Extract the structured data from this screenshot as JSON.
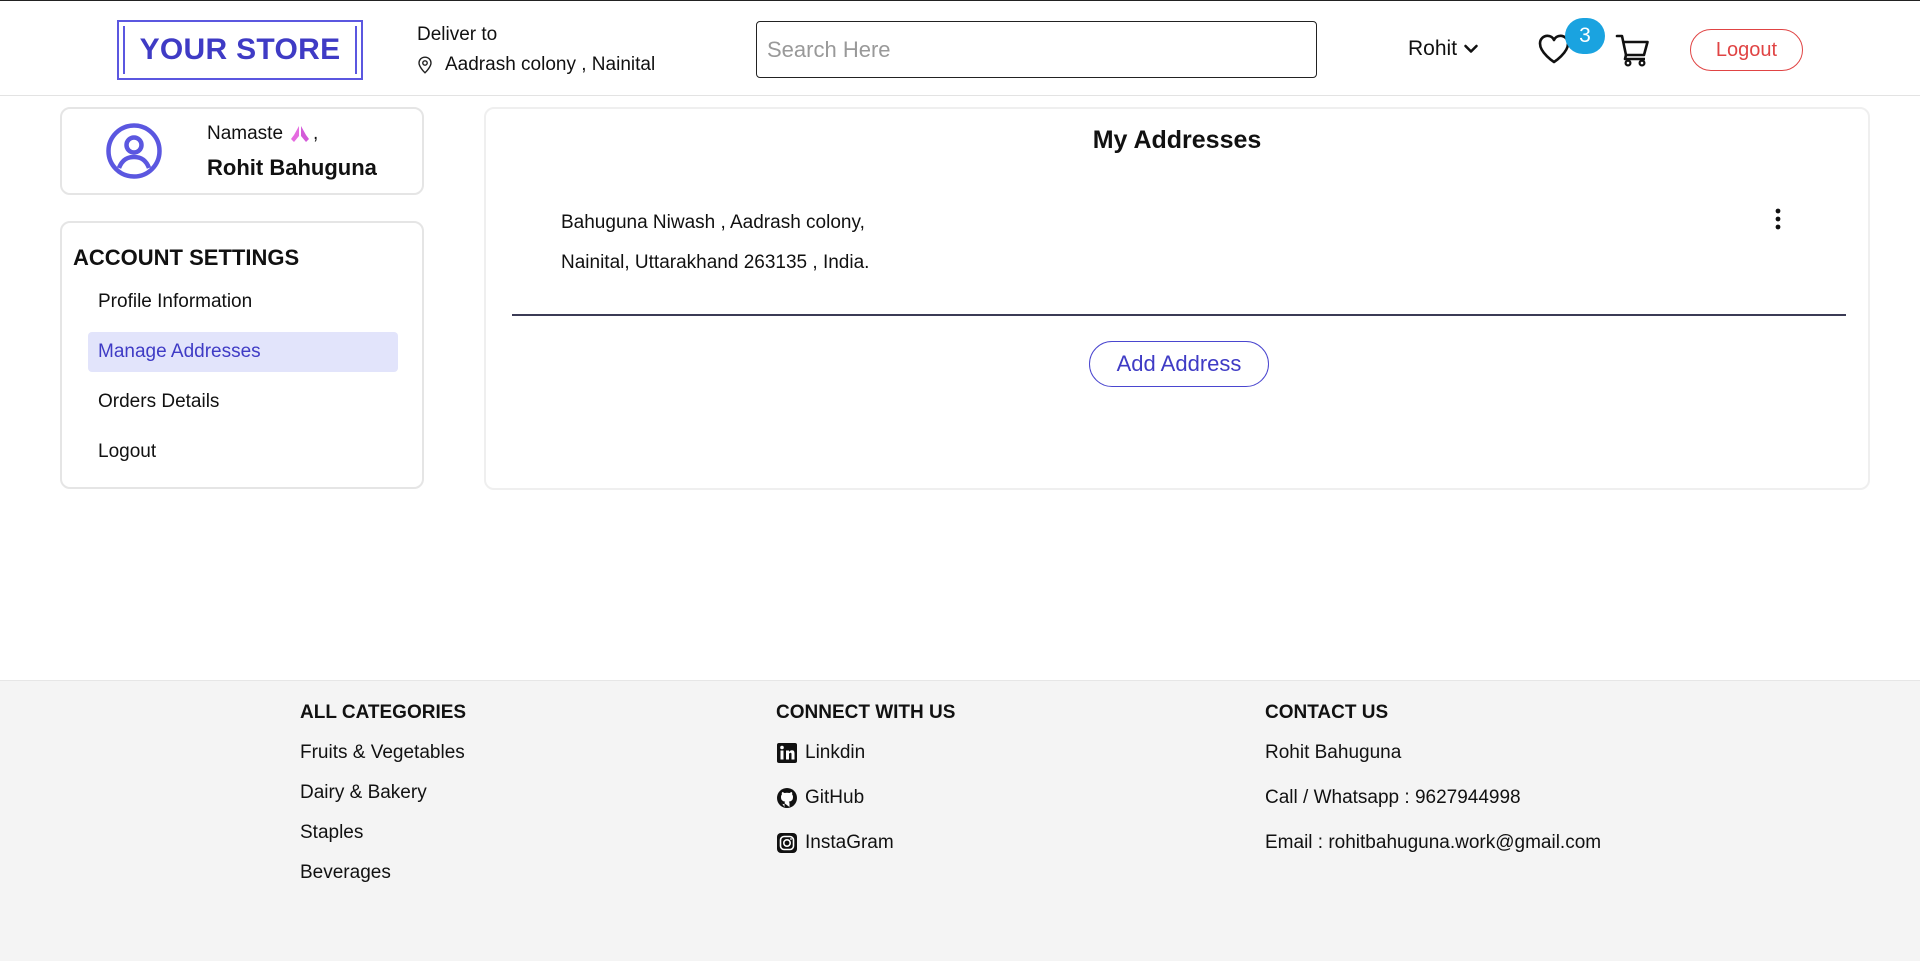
{
  "header": {
    "logo_text": "YOUR STORE",
    "deliver_label": "Deliver to",
    "deliver_location": "Aadrash colony , Nainital",
    "search_placeholder": "Search Here",
    "user_name": "Rohit",
    "wishlist_count": "3",
    "logout_label": "Logout"
  },
  "sidebar": {
    "greeting": "Namaste",
    "greeting_suffix": ",",
    "full_name": "Rohit Bahuguna",
    "settings_title": "ACCOUNT SETTINGS",
    "items": [
      {
        "label": "Profile Information",
        "active": false
      },
      {
        "label": "Manage Addresses",
        "active": true
      },
      {
        "label": "Orders Details",
        "active": false
      },
      {
        "label": "Logout",
        "active": false
      }
    ]
  },
  "main": {
    "title": "My Addresses",
    "address_line1": "Bahuguna Niwash , Aadrash colony,",
    "address_line2": "Nainital, Uttarakhand 263135 , India.",
    "add_button": "Add Address"
  },
  "footer": {
    "categories_title": "ALL CATEGORIES",
    "categories": [
      "Fruits & Vegetables",
      "Dairy & Bakery",
      "Staples",
      "Beverages"
    ],
    "connect_title": "CONNECT WITH US",
    "social": [
      {
        "label": "Linkdin",
        "icon": "linkedin-icon"
      },
      {
        "label": "GitHub",
        "icon": "github-icon"
      },
      {
        "label": "InstaGram",
        "icon": "instagram-icon"
      }
    ],
    "contact_title": "CONTACT US",
    "contact_name": "Rohit Bahuguna",
    "contact_phone": "Call / Whatsapp : 9627944998",
    "contact_email": "Email : rohitbahuguna.work@gmail.com"
  },
  "colors": {
    "brand": "#3f3bc5",
    "logout": "#e04444",
    "badge": "#1aa3e0",
    "active_bg": "#e2e4fb"
  }
}
